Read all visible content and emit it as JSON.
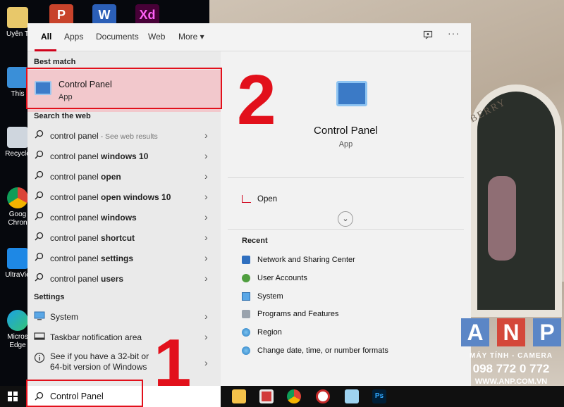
{
  "desktop": {
    "icons": [
      {
        "label": "Uyên T"
      },
      {
        "label": "This"
      },
      {
        "label": "Recycle"
      },
      {
        "label": "Goog Chron"
      },
      {
        "label": "UltraVie"
      },
      {
        "label": "Micros Edge"
      }
    ],
    "top_apps": [
      "P",
      "W",
      "Xd"
    ]
  },
  "start_menu": {
    "tabs": [
      "All",
      "Apps",
      "Documents",
      "Web",
      "More ▾"
    ],
    "best_match": {
      "header": "Best match",
      "title": "Control Panel",
      "subtitle": "App"
    },
    "search_web": {
      "header": "Search the web",
      "items": [
        {
          "prefix": "control panel",
          "bold": "",
          "hint": " - See web results"
        },
        {
          "prefix": "control panel ",
          "bold": "windows 10",
          "hint": ""
        },
        {
          "prefix": "control panel ",
          "bold": "open",
          "hint": ""
        },
        {
          "prefix": "control panel ",
          "bold": "open windows 10",
          "hint": ""
        },
        {
          "prefix": "control panel ",
          "bold": "windows",
          "hint": ""
        },
        {
          "prefix": "control panel ",
          "bold": "shortcut",
          "hint": ""
        },
        {
          "prefix": "control panel ",
          "bold": "settings",
          "hint": ""
        },
        {
          "prefix": "control panel ",
          "bold": "users",
          "hint": ""
        }
      ]
    },
    "settings": {
      "header": "Settings",
      "items": [
        {
          "label": "System"
        },
        {
          "label": "Taskbar notification area"
        },
        {
          "label": "See if you have a 32-bit or 64-bit version of Windows"
        }
      ]
    },
    "detail": {
      "title": "Control Panel",
      "subtitle": "App",
      "open_label": "Open",
      "expand_icon": "chevron-down",
      "recent_header": "Recent",
      "recent": [
        {
          "label": "Network and Sharing Center"
        },
        {
          "label": "User Accounts"
        },
        {
          "label": "System"
        },
        {
          "label": "Programs and Features"
        },
        {
          "label": "Region"
        },
        {
          "label": "Change date, time, or number formats"
        }
      ]
    }
  },
  "annotations": {
    "step1": "1",
    "step2": "2",
    "color": "#e2101b"
  },
  "taskbar": {
    "search_value": "Control Panel"
  },
  "watermark": {
    "letters": [
      "A",
      "N",
      "P"
    ],
    "line1": "MÁY TÍNH - CAMERA",
    "line2": "098 772 0 772",
    "line3": "WWW.ANP.COM.VN"
  }
}
